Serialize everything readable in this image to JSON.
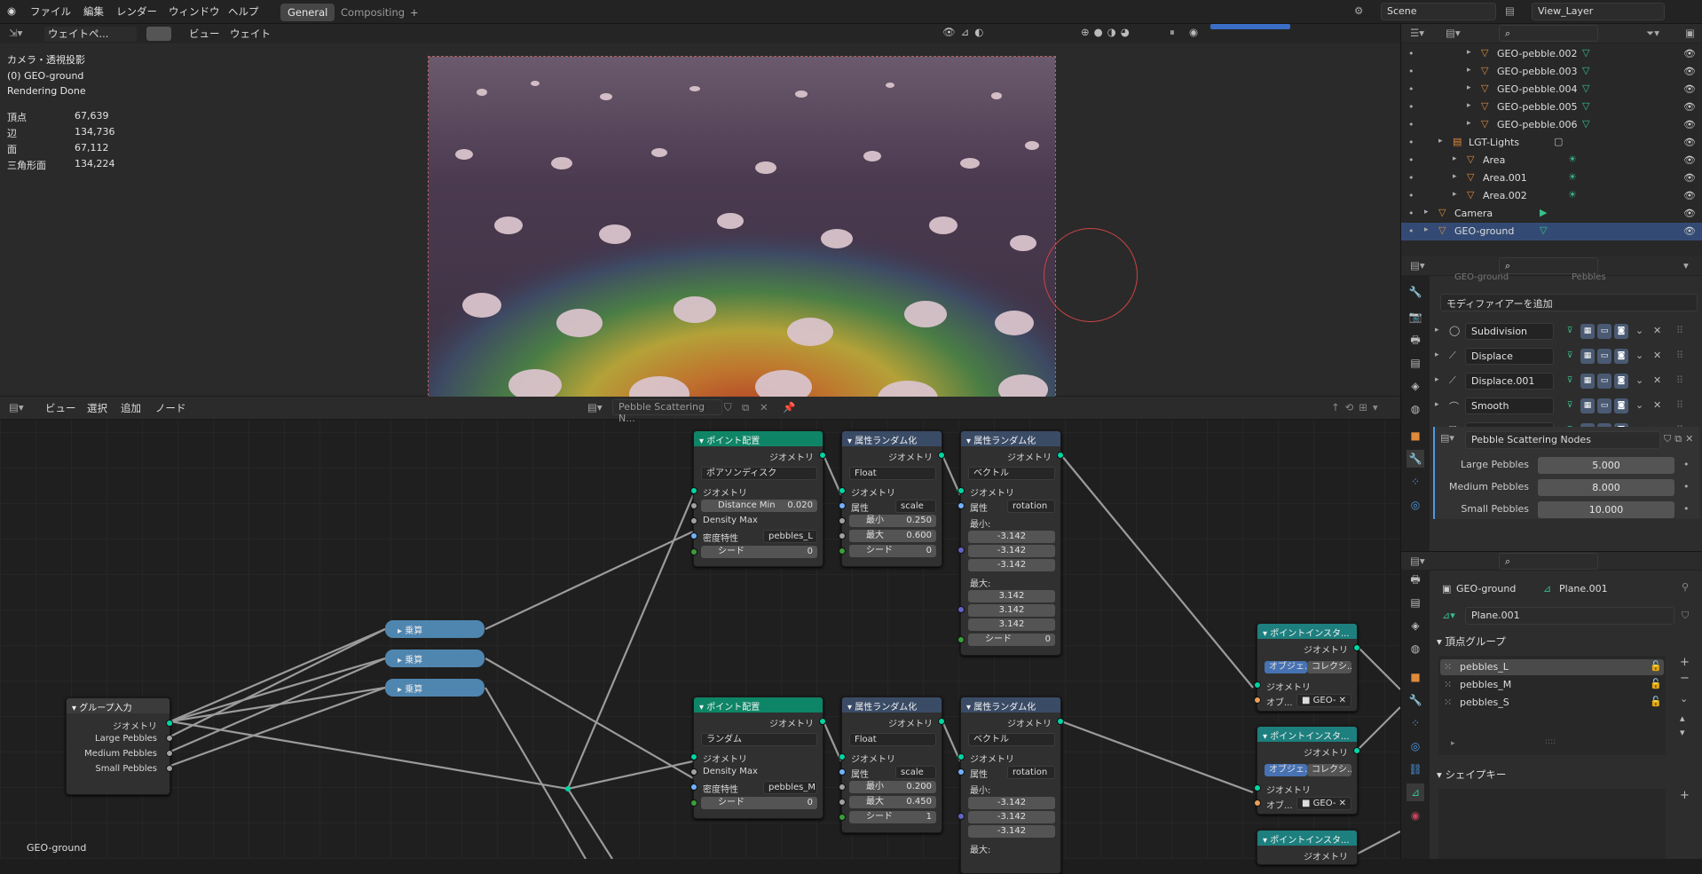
{
  "topbar": {
    "menus": [
      "ファイル",
      "編集",
      "レンダー",
      "ウィンドウ",
      "ヘルプ"
    ],
    "tabs": [
      "General",
      "Compositing"
    ],
    "scene": "Scene",
    "view_layer": "View_Layer"
  },
  "viewport": {
    "header": {
      "mode": "ウェイトペ...",
      "view": "ビュー",
      "weight": "ウェイト"
    },
    "overlay": {
      "line1": "カメラ・透視投影",
      "line2": "(0) GEO-ground",
      "line3": "Rendering Done"
    },
    "stats": [
      {
        "k": "頂点",
        "v": "67,639"
      },
      {
        "k": "辺",
        "v": "134,736"
      },
      {
        "k": "面",
        "v": "67,112"
      },
      {
        "k": "三角形面",
        "v": "134,224"
      }
    ],
    "footer": "GEO-ground"
  },
  "node_editor": {
    "header": {
      "view": "ビュー",
      "select": "選択",
      "add": "追加",
      "node": "ノード",
      "tree": "Pebble Scattering N..."
    },
    "group_input": {
      "title": "グループ入力",
      "outputs": [
        "ジオメトリ",
        "Large Pebbles",
        "Medium Pebbles",
        "Small Pebbles"
      ]
    },
    "math": [
      "乗算",
      "乗算",
      "乗算"
    ],
    "pd1": {
      "title": "ポイント配置",
      "out": "ジオメトリ",
      "mode": "ポアソンディスク",
      "geo": "ジオメトリ",
      "dmin_l": "Distance Min",
      "dmin_v": "0.020",
      "dmax": "Density Max",
      "dens_l": "密度特性",
      "dens_v": "pebbles_L",
      "seed_l": "シード",
      "seed_v": "0"
    },
    "ar1": {
      "title": "属性ランダム化",
      "out": "ジオメトリ",
      "type": "Float",
      "geo": "ジオメトリ",
      "attr_l": "属性",
      "attr_v": "scale",
      "min_l": "最小",
      "min_v": "0.250",
      "max_l": "最大",
      "max_v": "0.600",
      "seed_l": "シード",
      "seed_v": "0"
    },
    "ar2": {
      "title": "属性ランダム化",
      "out": "ジオメトリ",
      "type": "ベクトル",
      "geo": "ジオメトリ",
      "attr_l": "属性",
      "attr_v": "rotation",
      "min_h": "最小:",
      "mins": [
        "-3.142",
        "-3.142",
        "-3.142"
      ],
      "max_h": "最大:",
      "maxs": [
        "3.142",
        "3.142",
        "3.142"
      ],
      "seed_l": "シード",
      "seed_v": "0"
    },
    "pd2": {
      "title": "ポイント配置",
      "out": "ジオメトリ",
      "mode": "ランダム",
      "geo": "ジオメトリ",
      "dmax": "Density Max",
      "dens_l": "密度特性",
      "dens_v": "pebbles_M",
      "seed_l": "シード",
      "seed_v": "0"
    },
    "ar3": {
      "title": "属性ランダム化",
      "out": "ジオメトリ",
      "type": "Float",
      "geo": "ジオメトリ",
      "attr_l": "属性",
      "attr_v": "scale",
      "min_l": "最小",
      "min_v": "0.200",
      "max_l": "最大",
      "max_v": "0.450",
      "seed_l": "シード",
      "seed_v": "1"
    },
    "ar4": {
      "title": "属性ランダム化",
      "out": "ジオメトリ",
      "type": "ベクトル",
      "geo": "ジオメトリ",
      "attr_l": "属性",
      "attr_v": "rotation",
      "min_h": "最小:",
      "mins": [
        "-3.142",
        "-3.142",
        "-3.142"
      ],
      "max_h": "最大:"
    },
    "pi": {
      "title": "ポイントインスタ...",
      "out": "ジオメトリ",
      "obj_tab": "オブジェ...",
      "col_tab": "コレクシ...",
      "in": "ジオメトリ",
      "ob_l": "オブ...",
      "ob_v": "GEO-"
    }
  },
  "outliner": {
    "rows": [
      {
        "name": "GEO-pebble.002",
        "indent": 4,
        "kind": "mesh"
      },
      {
        "name": "GEO-pebble.003",
        "indent": 4,
        "kind": "mesh"
      },
      {
        "name": "GEO-pebble.004",
        "indent": 4,
        "kind": "mesh"
      },
      {
        "name": "GEO-pebble.005",
        "indent": 4,
        "kind": "mesh"
      },
      {
        "name": "GEO-pebble.006",
        "indent": 4,
        "kind": "mesh"
      },
      {
        "name": "LGT-Lights",
        "indent": 2,
        "kind": "collection"
      },
      {
        "name": "Area",
        "indent": 3,
        "kind": "light"
      },
      {
        "name": "Area.001",
        "indent": 3,
        "kind": "light"
      },
      {
        "name": "Area.002",
        "indent": 3,
        "kind": "light"
      },
      {
        "name": "Camera",
        "indent": 1,
        "kind": "camera"
      },
      {
        "name": "GEO-ground",
        "indent": 1,
        "kind": "mesh",
        "selected": true
      }
    ]
  },
  "modifiers": {
    "prev": "GEO-ground",
    "prev2": "Pebbles",
    "add": "モディファイアーを追加",
    "items": [
      "Subdivision",
      "Displace",
      "Displace.001",
      "Smooth",
      "Pebbles"
    ],
    "nodegroup": "Pebble Scattering Nodes",
    "params": [
      {
        "k": "Large Pebbles",
        "v": "5.000"
      },
      {
        "k": "Medium Pebbles",
        "v": "8.000"
      },
      {
        "k": "Small Pebbles",
        "v": "10.000"
      }
    ]
  },
  "data": {
    "object": "GEO-ground",
    "mesh": "Plane.001",
    "mesh_field": "Plane.001",
    "vg_title": "頂点グループ",
    "groups": [
      "pebbles_L",
      "pebbles_M",
      "pebbles_S"
    ],
    "sk_title": "シェイプキー"
  }
}
